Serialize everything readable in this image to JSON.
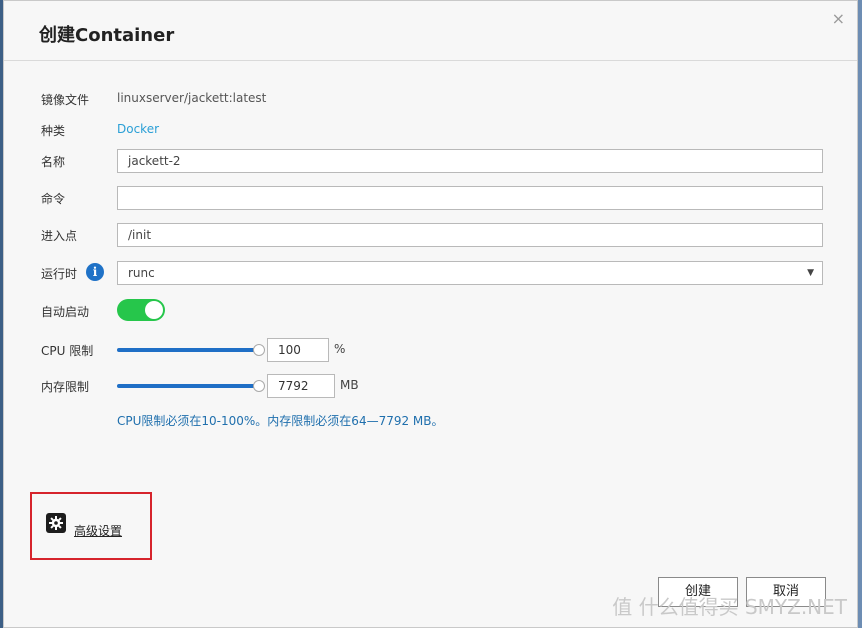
{
  "dialog": {
    "title": "创建Container",
    "close_label": "×"
  },
  "form": {
    "image_label": "镜像文件",
    "image_value": "linuxserver/jackett:latest",
    "type_label": "种类",
    "type_value": "Docker",
    "name_label": "名称",
    "name_value": "jackett-2",
    "command_label": "命令",
    "command_value": "",
    "entrypoint_label": "进入点",
    "entrypoint_value": "/init",
    "runtime_label": "运行时",
    "runtime_value": "runc",
    "autostart_label": "自动启动",
    "autostart_on": true,
    "cpu_label": "CPU 限制",
    "cpu_value": "100",
    "cpu_unit": "%",
    "cpu_slider_fraction": 1.0,
    "mem_label": "内存限制",
    "mem_value": "7792",
    "mem_unit": "MB",
    "mem_slider_fraction": 1.0,
    "hint": "CPU限制必须在10-100%。内存限制必须在64—7792 MB。"
  },
  "advanced": {
    "label": "高级设置",
    "icon": "gear-icon"
  },
  "buttons": {
    "create": "创建",
    "cancel": "取消"
  },
  "watermark": "值 什么值得买 SMYZ.NET",
  "colors": {
    "accent_blue": "#1f6fc6",
    "toggle_green": "#26c64b",
    "highlight_red": "#d6242c",
    "link_blue": "#2a9fd6"
  }
}
